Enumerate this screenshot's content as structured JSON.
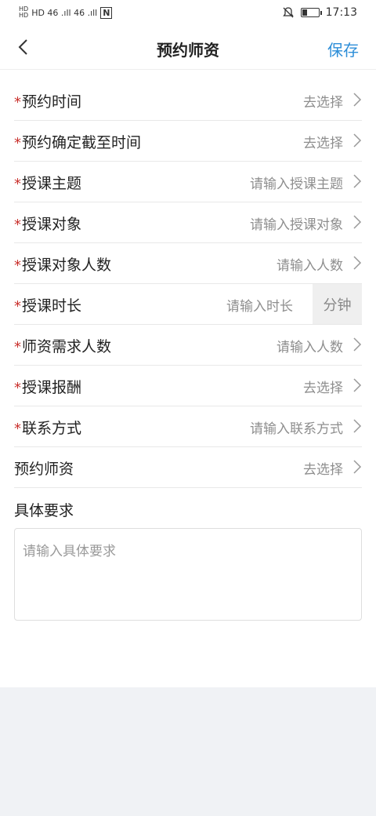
{
  "status_bar": {
    "network_left": "HD 46 .ıll 46 .ıll",
    "nfc": "N",
    "time": "17:13"
  },
  "header": {
    "title": "预约师资",
    "save_label": "保存"
  },
  "required_mark": "*",
  "rows": [
    {
      "label": "预约时间",
      "value": "去选择",
      "required": true
    },
    {
      "label": "预约确定截至时间",
      "value": "去选择",
      "required": true
    },
    {
      "label": "授课主题",
      "value": "请输入授课主题",
      "required": true
    },
    {
      "label": "授课对象",
      "value": "请输入授课对象",
      "required": true
    },
    {
      "label": "授课对象人数",
      "value": "请输入人数",
      "required": true
    },
    {
      "label": "授课时长",
      "value": "请输入时长",
      "unit": "分钟",
      "required": true
    },
    {
      "label": "师资需求人数",
      "value": "请输入人数",
      "required": true
    },
    {
      "label": "授课报酬",
      "value": "去选择",
      "required": true
    },
    {
      "label": "联系方式",
      "value": "请输入联系方式",
      "required": true
    },
    {
      "label": "预约师资",
      "value": "去选择",
      "required": false
    }
  ],
  "requirements": {
    "label": "具体要求",
    "placeholder": "请输入具体要求"
  },
  "colors": {
    "accent": "#2d8ed8",
    "required": "#c9302c",
    "page_bg": "#f0f2f5"
  }
}
